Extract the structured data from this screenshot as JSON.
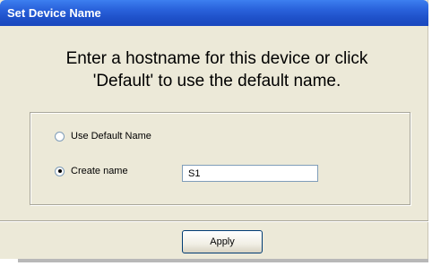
{
  "window": {
    "title": "Set Device Name"
  },
  "prompt": {
    "line1": "Enter a hostname for this device or click",
    "line2": "'Default' to use the default name."
  },
  "options": {
    "default_label": "Use Default Name",
    "create_label": "Create name",
    "selected": "create"
  },
  "hostname_input": {
    "value": "S1"
  },
  "buttons": {
    "apply_label": "Apply"
  },
  "colors": {
    "titlebar": "#2a63dc",
    "dialog_bg": "#ece9d8"
  }
}
